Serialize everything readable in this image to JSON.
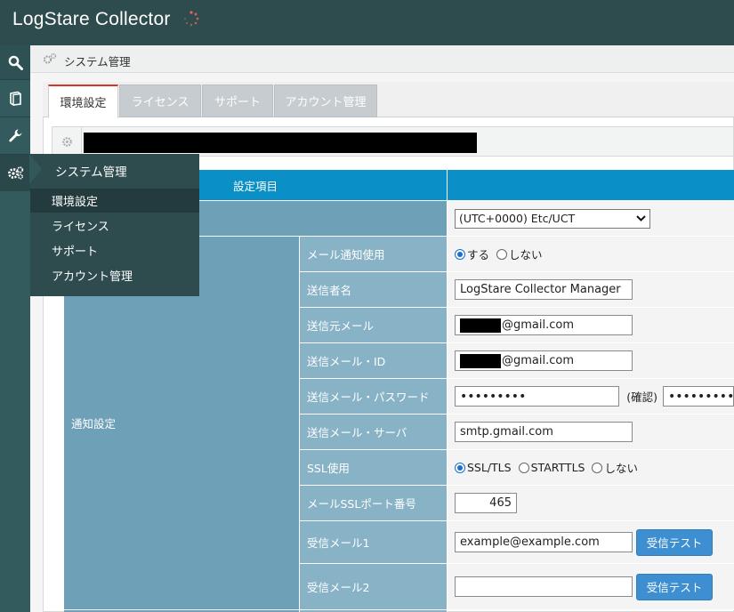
{
  "app": {
    "title": "LogStare Collector",
    "spinner_color": "#e8684a"
  },
  "breadcrumb": {
    "label": "システム管理"
  },
  "tabs": [
    {
      "label": "環境設定",
      "active": true
    },
    {
      "label": "ライセンス",
      "active": false
    },
    {
      "label": "サポート",
      "active": false
    },
    {
      "label": "アカウント管理",
      "active": false
    }
  ],
  "flyout": {
    "title": "システム管理",
    "items": [
      {
        "label": "環境設定",
        "active": true
      },
      {
        "label": "ライセンス",
        "active": false
      },
      {
        "label": "サポート",
        "active": false
      },
      {
        "label": "アカウント管理",
        "active": false
      }
    ]
  },
  "table": {
    "header": "設定項目",
    "timezone_value": "(UTC+0000) Etc/UCT",
    "category_notify": "通知設定",
    "rows": {
      "mail_use": {
        "label": "メール通知使用",
        "options": [
          "する",
          "しない"
        ],
        "selected": "する"
      },
      "sender_name": {
        "label": "送信者名",
        "value": "LogStare Collector Manager"
      },
      "from_mail": {
        "label": "送信元メール",
        "value_suffix": "@gmail.com"
      },
      "mail_id": {
        "label": "送信メール・ID",
        "value_suffix": "@gmail.com"
      },
      "mail_password": {
        "label": "送信メール・パスワード",
        "value": "•••••••••",
        "confirm_label": "(確認)",
        "confirm_value": "•••••••••"
      },
      "mail_server": {
        "label": "送信メール・サーバ",
        "value": "smtp.gmail.com"
      },
      "ssl_use": {
        "label": "SSL使用",
        "options": [
          "SSL/TLS",
          "STARTTLS",
          "しない"
        ],
        "selected": "SSL/TLS"
      },
      "ssl_port": {
        "label": "メールSSLポート番号",
        "value": "465"
      },
      "recv_mail1": {
        "label": "受信メール1",
        "value": "example@example.com",
        "button": "受信テスト"
      },
      "recv_mail2": {
        "label": "受信メール2",
        "value": "",
        "button": "受信テスト"
      }
    }
  },
  "colors": {
    "topbar": "#2e4b4d",
    "header_blue": "#0a8fc6",
    "label_cell": "#88b3c6",
    "category_cell": "#6ea0b8",
    "button_blue": "#3d8fd1",
    "active_tab_accent": "#d9342b"
  },
  "icons": {
    "nav": [
      "search-icon",
      "book-icon",
      "wrench-icon",
      "gears-icon"
    ],
    "breadcrumb": "gears-icon",
    "toolbar": "gear-icon"
  }
}
